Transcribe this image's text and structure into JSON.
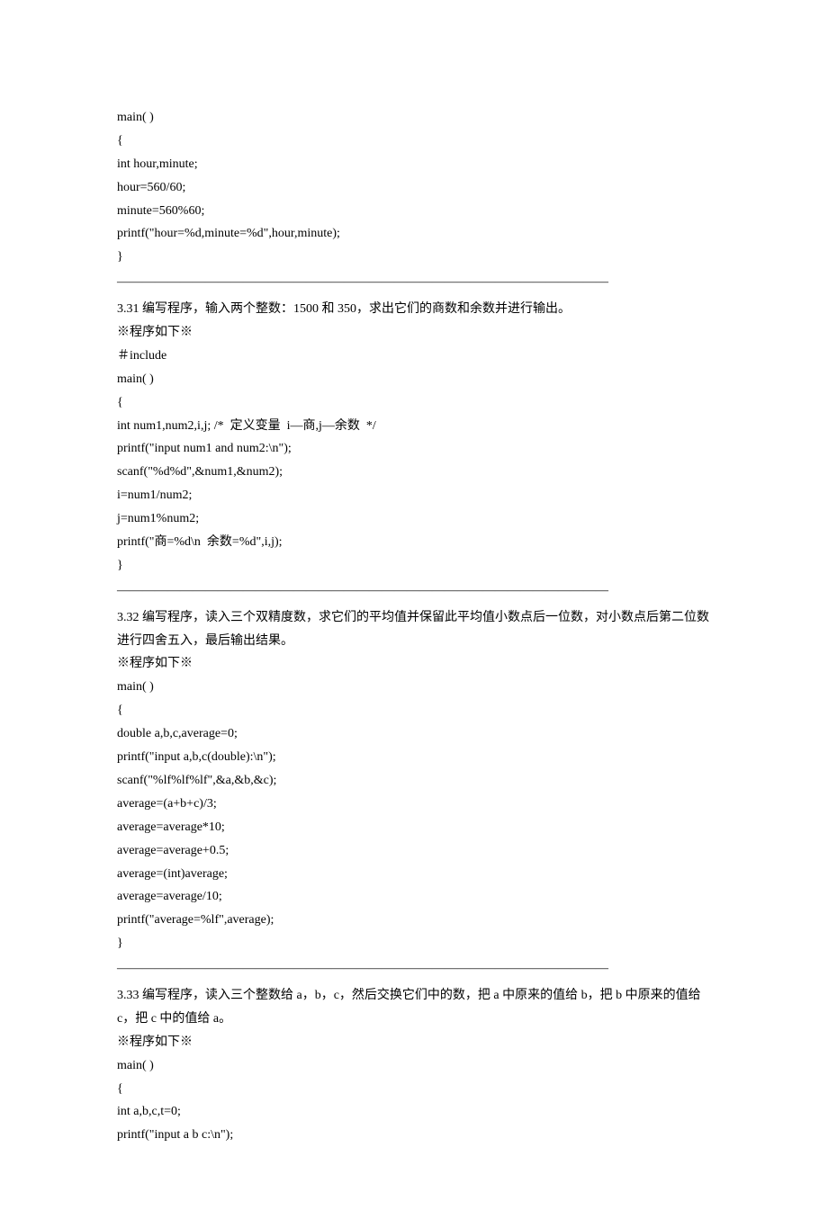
{
  "lines": [
    "main( )",
    "{",
    "int hour,minute;",
    "hour=560/60;",
    "minute=560%60;",
    "printf(\"hour=%d,minute=%d\",hour,minute);",
    "}",
    "———————————————————————————————————————",
    "3.31 编写程序，输入两个整数：1500 和 350，求出它们的商数和余数并进行输出。",
    "※程序如下※",
    "＃include",
    "main( )",
    "{",
    "int num1,num2,i,j; /*  定义变量  i—商,j—余数  */",
    "printf(\"input num1 and num2:\\n\");",
    "scanf(\"%d%d\",&num1,&num2);",
    "i=num1/num2;",
    "j=num1%num2;",
    "printf(\"商=%d\\n  余数=%d\",i,j);",
    "}",
    "———————————————————————————————————————",
    "3.32 编写程序，读入三个双精度数，求它们的平均值并保留此平均值小数点后一位数，对小数点后第二位数进行四舍五入，最后输出结果。",
    "※程序如下※",
    "main( )",
    "{",
    "double a,b,c,average=0;",
    "printf(\"input a,b,c(double):\\n\");",
    "scanf(\"%lf%lf%lf\",&a,&b,&c);",
    "average=(a+b+c)/3;",
    "average=average*10;",
    "average=average+0.5;",
    "average=(int)average;",
    "average=average/10;",
    "printf(\"average=%lf\",average);",
    "}",
    "———————————————————————————————————————",
    "3.33 编写程序，读入三个整数给 a，b，c，然后交换它们中的数，把 a 中原来的值给 b，把 b 中原来的值给 c，把 c 中的值给 a。",
    "※程序如下※",
    "main( )",
    "{",
    "int a,b,c,t=0;",
    "printf(\"input a b c:\\n\");"
  ]
}
